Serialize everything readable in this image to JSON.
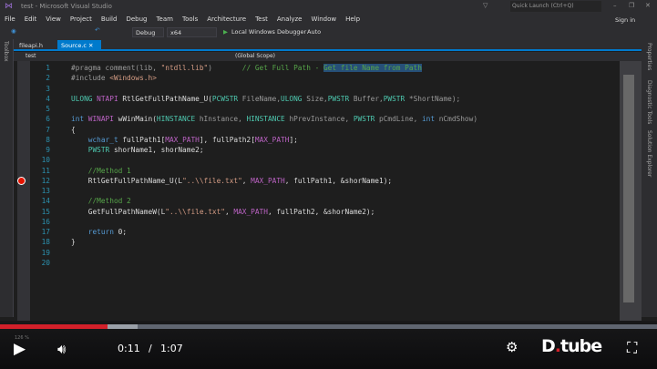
{
  "window": {
    "title": "test - Microsoft Visual Studio",
    "quick_launch_placeholder": "Quick Launch (Ctrl+Q)",
    "sign_in": "Sign in"
  },
  "menu": [
    "File",
    "Edit",
    "View",
    "Project",
    "Build",
    "Debug",
    "Team",
    "Tools",
    "Architecture",
    "Test",
    "Analyze",
    "Window",
    "Help"
  ],
  "toolbar": {
    "config": "Debug",
    "platform": "x64",
    "debugger": "Local Windows Debugger",
    "debugger_mode": "Auto"
  },
  "side_panels": {
    "left": "Toolbox",
    "right": [
      "Properties",
      "Diagnostic Tools",
      "Solution Explorer"
    ]
  },
  "tabs": [
    {
      "label": "fileapi.h",
      "active": false
    },
    {
      "label": "Source.c",
      "active": true
    }
  ],
  "navbar": {
    "project": "test",
    "scope": "(Global Scope)"
  },
  "code": [
    [
      [
        "#pragma comment(lib, ",
        "pp"
      ],
      [
        "\"ntdll.lib\"",
        "str"
      ],
      [
        ")       ",
        "pp"
      ],
      [
        "// Get Full Path - ",
        "cm"
      ],
      [
        "Get file Name from Path",
        "sel"
      ]
    ],
    [
      [
        "#include ",
        "pp"
      ],
      [
        "<Windows.h>",
        "str"
      ]
    ],
    [],
    [
      [
        "ULONG ",
        "ty"
      ],
      [
        "NTAPI ",
        "mac"
      ],
      [
        "RtlGetFullPathName_U(",
        "tx"
      ],
      [
        "PCWSTR ",
        "ty"
      ],
      [
        "FileName,",
        "pa"
      ],
      [
        "ULONG ",
        "ty"
      ],
      [
        "Size,",
        "pa"
      ],
      [
        "PWSTR ",
        "ty"
      ],
      [
        "Buffer,",
        "pa"
      ],
      [
        "PWSTR ",
        "ty"
      ],
      [
        "*ShortName);",
        "pa"
      ]
    ],
    [],
    [
      [
        "int ",
        "kw"
      ],
      [
        "WINAPI ",
        "mac"
      ],
      [
        "wWinMain(",
        "tx"
      ],
      [
        "HINSTANCE ",
        "ty"
      ],
      [
        "hInstance, ",
        "pa"
      ],
      [
        "HINSTANCE ",
        "ty"
      ],
      [
        "hPrevInstance, ",
        "pa"
      ],
      [
        "PWSTR ",
        "ty"
      ],
      [
        "pCmdLine, ",
        "pa"
      ],
      [
        "int ",
        "kw"
      ],
      [
        "nCmdShow)",
        "pa"
      ]
    ],
    [
      [
        "{",
        "tx"
      ]
    ],
    [
      [
        "    ",
        "tx"
      ],
      [
        "wchar_t ",
        "kw"
      ],
      [
        "fullPath1[",
        "tx"
      ],
      [
        "MAX_PATH",
        "mac"
      ],
      [
        "], fullPath2[",
        "tx"
      ],
      [
        "MAX_PATH",
        "mac"
      ],
      [
        "];",
        "tx"
      ]
    ],
    [
      [
        "    ",
        "tx"
      ],
      [
        "PWSTR ",
        "ty"
      ],
      [
        "shorName1, shorName2;",
        "tx"
      ]
    ],
    [],
    [
      [
        "    ",
        "tx"
      ],
      [
        "//Method 1",
        "cm"
      ]
    ],
    [
      [
        "    RtlGetFullPathName_U(L",
        "tx"
      ],
      [
        "\"..\\\\file.txt\"",
        "str"
      ],
      [
        ", ",
        "tx"
      ],
      [
        "MAX_PATH",
        "mac"
      ],
      [
        ", fullPath1, &shorName1);",
        "tx"
      ]
    ],
    [],
    [
      [
        "    ",
        "tx"
      ],
      [
        "//Method 2",
        "cm"
      ]
    ],
    [
      [
        "    GetFullPathNameW(L",
        "tx"
      ],
      [
        "\"..\\\\file.txt\"",
        "str"
      ],
      [
        ", ",
        "tx"
      ],
      [
        "MAX_PATH",
        "mac"
      ],
      [
        ", fullPath2, &shorName2);",
        "tx"
      ]
    ],
    [],
    [
      [
        "    ",
        "tx"
      ],
      [
        "return ",
        "kw"
      ],
      [
        "0;",
        "tx"
      ]
    ],
    [
      [
        "}",
        "tx"
      ]
    ],
    [],
    []
  ],
  "breakpoint_line": 12,
  "zoom_level": "126 %",
  "player": {
    "current_time": "0:11",
    "separator": "/",
    "duration": "1:07",
    "played_percent": 16.4,
    "buffered_percent": 21,
    "brand": "D.tube",
    "accent": "#d2202a"
  }
}
